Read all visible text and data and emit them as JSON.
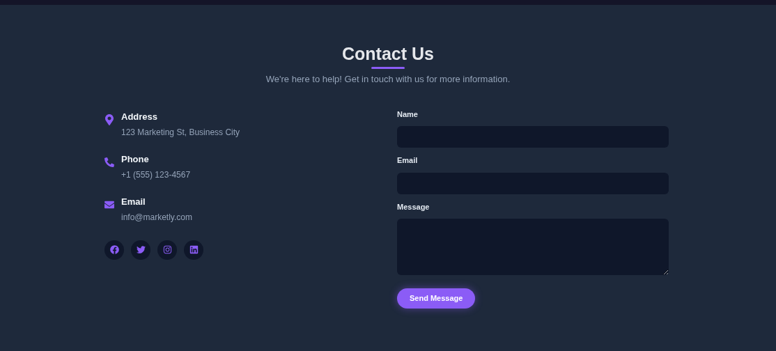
{
  "header": {
    "title": "Contact Us",
    "subtitle": "We're here to help! Get in touch with us for more information."
  },
  "contact_items": [
    {
      "kind": "address",
      "label": "Address",
      "value": "123 Marketing St, Business City"
    },
    {
      "kind": "phone",
      "label": "Phone",
      "value": "+1 (555) 123-4567"
    },
    {
      "kind": "email",
      "label": "Email",
      "value": "info@marketly.com"
    }
  ],
  "social_links": [
    {
      "kind": "facebook"
    },
    {
      "kind": "twitter"
    },
    {
      "kind": "instagram"
    },
    {
      "kind": "linkedin"
    }
  ],
  "form": {
    "fields": [
      {
        "kind": "input",
        "label": "Name"
      },
      {
        "kind": "input",
        "label": "Email"
      },
      {
        "kind": "textarea",
        "label": "Message"
      }
    ],
    "submit": "Send Message"
  }
}
